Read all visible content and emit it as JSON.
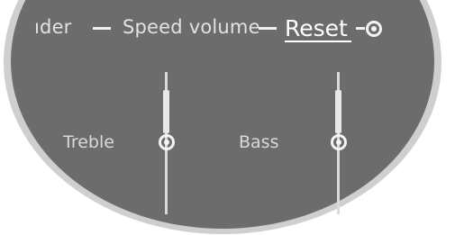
{
  "menu": {
    "items": [
      "ıder",
      "Speed volume"
    ],
    "reset_label": "Reset"
  },
  "sliders": [
    {
      "label": "Treble",
      "level": 0.5
    },
    {
      "label": "Bass",
      "level": 0.5
    }
  ],
  "colors": {
    "display_background": "#6c6c6c",
    "display_rim": "#cfcfcf",
    "highlight": "#ffffff"
  },
  "icons": {
    "controller": "controller-knob-icon"
  }
}
